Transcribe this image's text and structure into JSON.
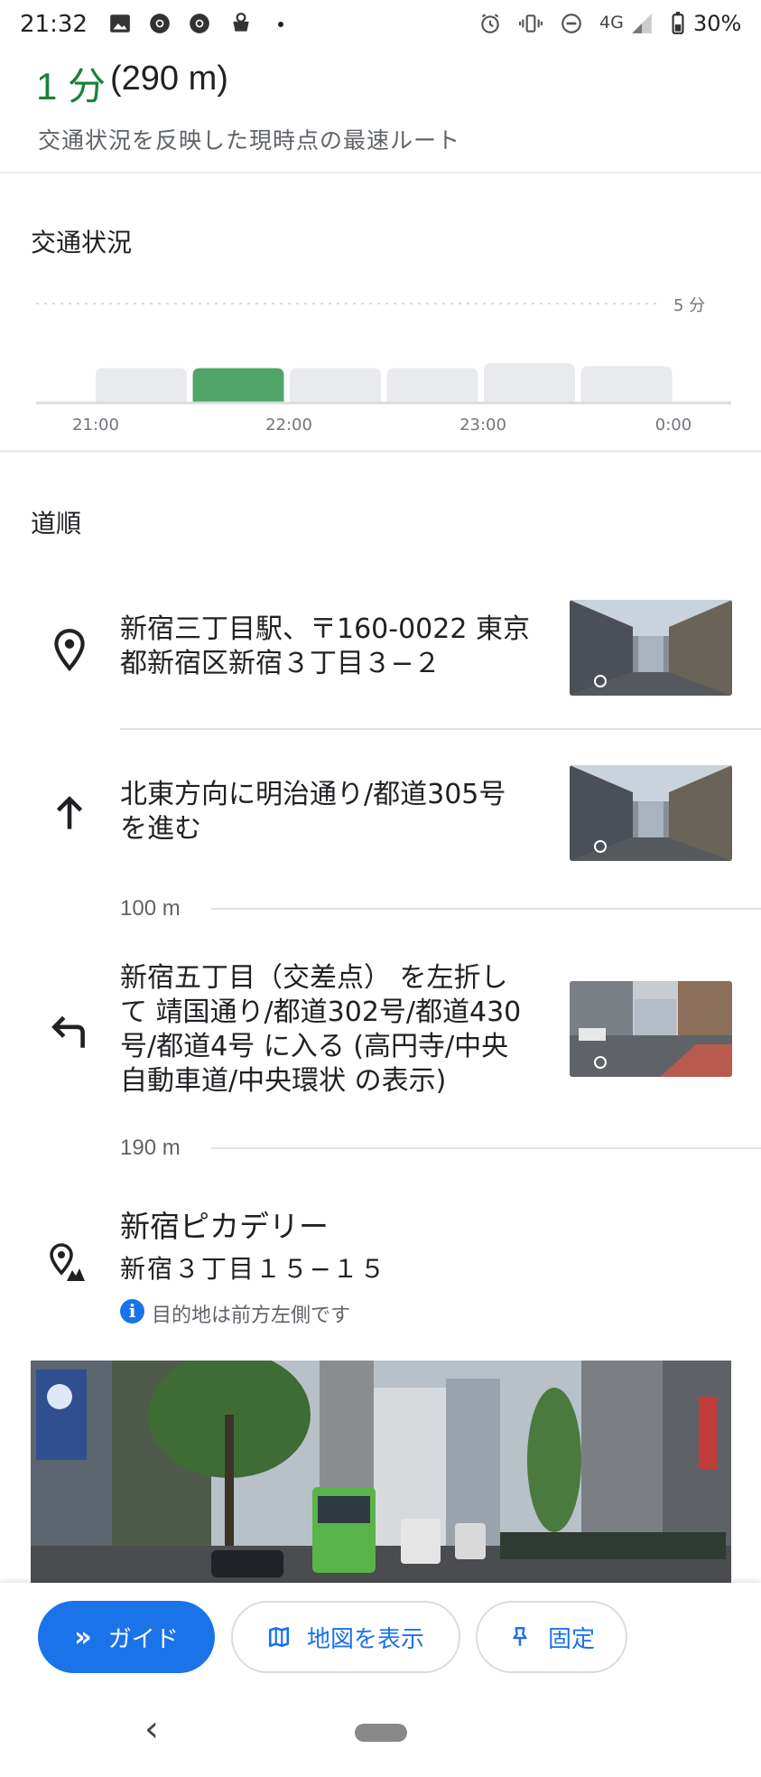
{
  "status_bar": {
    "time": "21:32",
    "network": "4G",
    "battery": "30%",
    "icons": [
      "gallery-icon",
      "chrome-icon",
      "chrome-icon",
      "app-icon",
      "alarm-icon",
      "vibrate-icon",
      "dnd-icon",
      "signal-icon",
      "battery-icon"
    ]
  },
  "header": {
    "eta_minutes": "1 分",
    "eta_distance": "(290 m)",
    "subtitle": "交通状況を反映した現時点の最速ルート"
  },
  "traffic": {
    "title": "交通状況",
    "chart_data": {
      "type": "bar",
      "y_reference_label": "5 分",
      "x_ticks": [
        "21:00",
        "22:00",
        "23:00",
        "0:00"
      ],
      "bars": [
        {
          "level": 0.35,
          "highlight": false
        },
        {
          "level": 0.35,
          "highlight": true
        },
        {
          "level": 0.35,
          "highlight": false
        },
        {
          "level": 0.35,
          "highlight": false
        },
        {
          "level": 0.4,
          "highlight": false
        },
        {
          "level": 0.37,
          "highlight": false
        }
      ],
      "colors": {
        "bar": "#e8eaed",
        "highlight": "#52a56a",
        "baseline": "#dadce0"
      }
    }
  },
  "directions": {
    "title": "道順",
    "steps": [
      {
        "icon": "location-pin-icon",
        "text_lines": [
          "新宿三丁目駅、〒160-0022 東京",
          "都新宿区新宿３丁目３−２"
        ]
      },
      {
        "icon": "arrow-up-icon",
        "text_lines": [
          "北東方向に明治通り/都道305号",
          "を進む"
        ],
        "distance_after": "100 m"
      },
      {
        "icon": "turn-left-icon",
        "text_lines": [
          "新宿五丁目（交差点） を左折し",
          "て 靖国通り/都道302号/都道430",
          "号/都道4号 に入る (高円寺/中央",
          "自動車道/中央環状 の表示)"
        ],
        "distance_after": "190 m"
      }
    ],
    "destination": {
      "name": "新宿ピカデリー",
      "address": "新宿３丁目１５−１５",
      "note": "目的地は前方左側です",
      "info_glyph": "i"
    }
  },
  "actions": {
    "guide_label": "ガイド",
    "guide_icon_glyph": "»",
    "map_label": "地図を表示",
    "pin_label": "固定"
  },
  "nav": {
    "back_glyph": "‹"
  },
  "colors": {
    "accent_green": "#188038",
    "accent_blue": "#1a73e8"
  }
}
